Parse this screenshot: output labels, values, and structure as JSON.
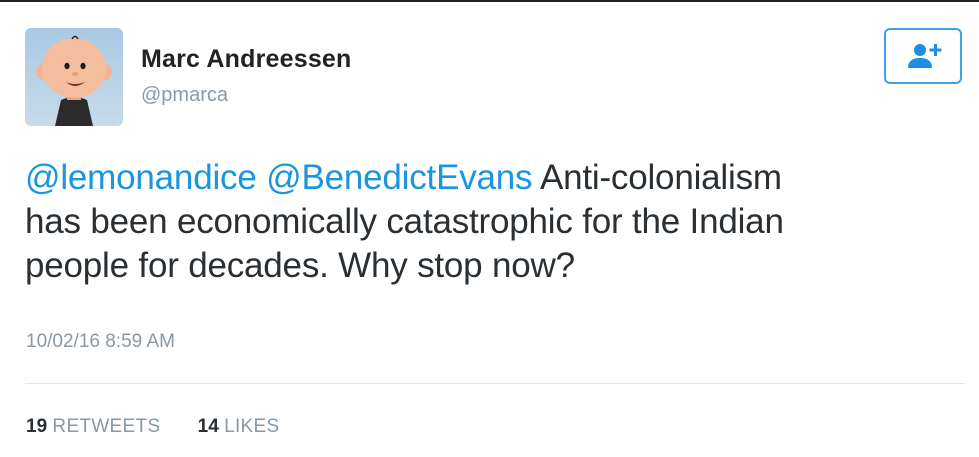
{
  "tweet": {
    "user": {
      "name": "Marc Andreessen",
      "handle": "@pmarca",
      "avatar_icon": "cartoon-avatar-icon"
    },
    "follow_icon": "follow-user-icon",
    "text": {
      "mentions": [
        "@lemonandice",
        "@BenedictEvans"
      ],
      "line1": " Anti-colonialism",
      "line2": "has been economically catastrophic for the Indian",
      "line3": "people for decades. Why stop now?"
    },
    "timestamp": "10/02/16 8:59 AM",
    "stats": {
      "retweets_count": "19",
      "retweets_label": "RETWEETS",
      "likes_count": "14",
      "likes_label": "LIKES"
    }
  },
  "colors": {
    "mention": "#1b95e0",
    "follow_border": "#3fa3e4",
    "muted": "#8899a6",
    "text": "#292f33"
  }
}
